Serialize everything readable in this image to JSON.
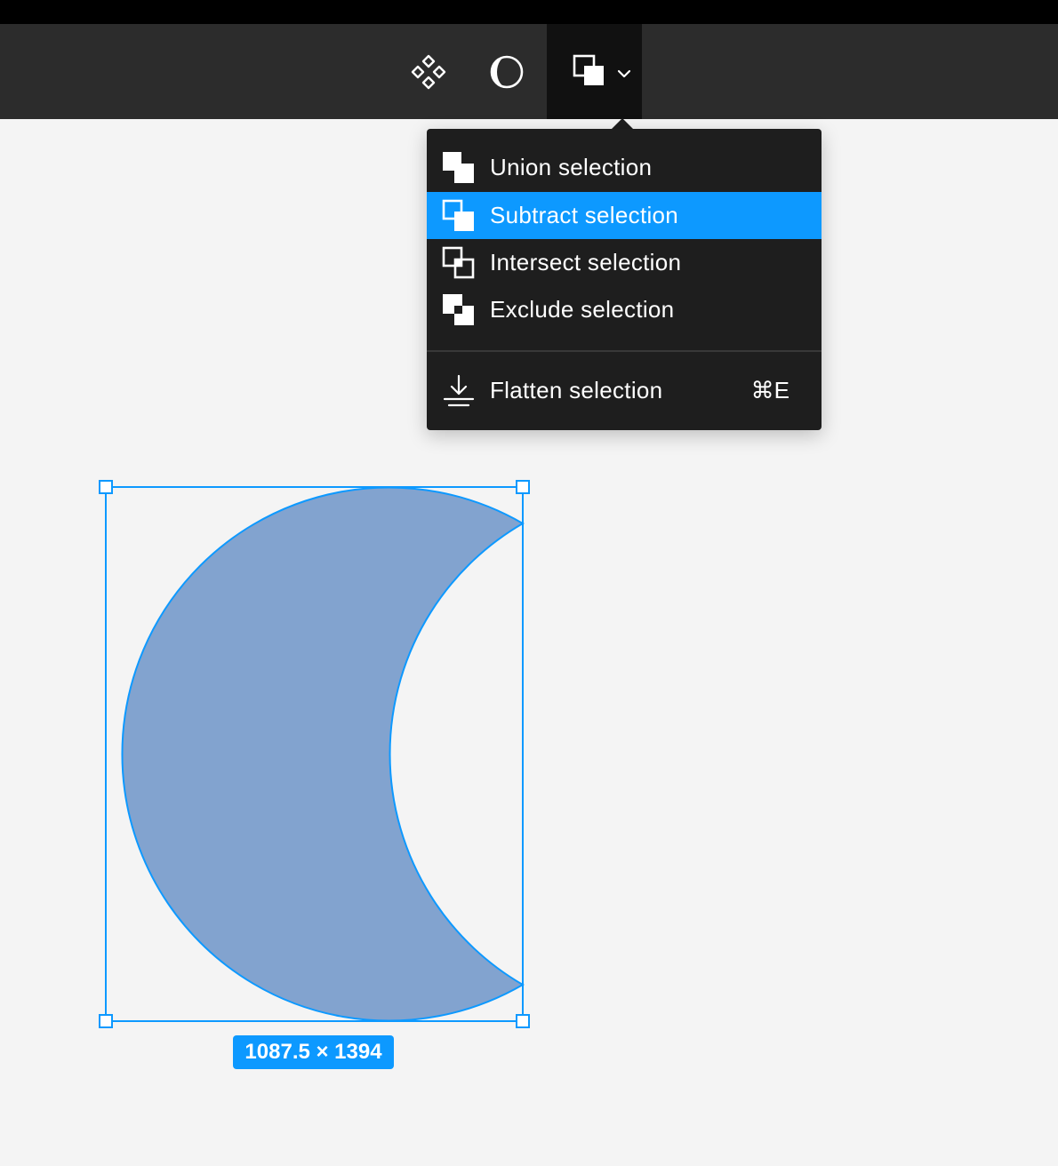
{
  "toolbar": {
    "tools": [
      {
        "name": "components-icon"
      },
      {
        "name": "mask-icon"
      },
      {
        "name": "boolean-operations-icon",
        "active": true
      }
    ]
  },
  "boolean_menu": {
    "items": [
      {
        "label": "Union selection",
        "icon": "union-icon"
      },
      {
        "label": "Subtract selection",
        "icon": "subtract-icon",
        "highlighted": true
      },
      {
        "label": "Intersect selection",
        "icon": "intersect-icon"
      },
      {
        "label": "Exclude selection",
        "icon": "exclude-icon"
      }
    ],
    "flatten": {
      "label": "Flatten selection",
      "shortcut": "⌘E",
      "icon": "flatten-icon"
    }
  },
  "selection": {
    "size_label": "1087.5 × 1394",
    "fill_color": "#82a3cf",
    "outline_color": "#0d99ff"
  },
  "colors": {
    "toolbar_bg": "#2c2c2c",
    "menu_bg": "#1e1e1e",
    "highlight": "#0d99ff",
    "canvas_bg": "#f4f4f4"
  }
}
